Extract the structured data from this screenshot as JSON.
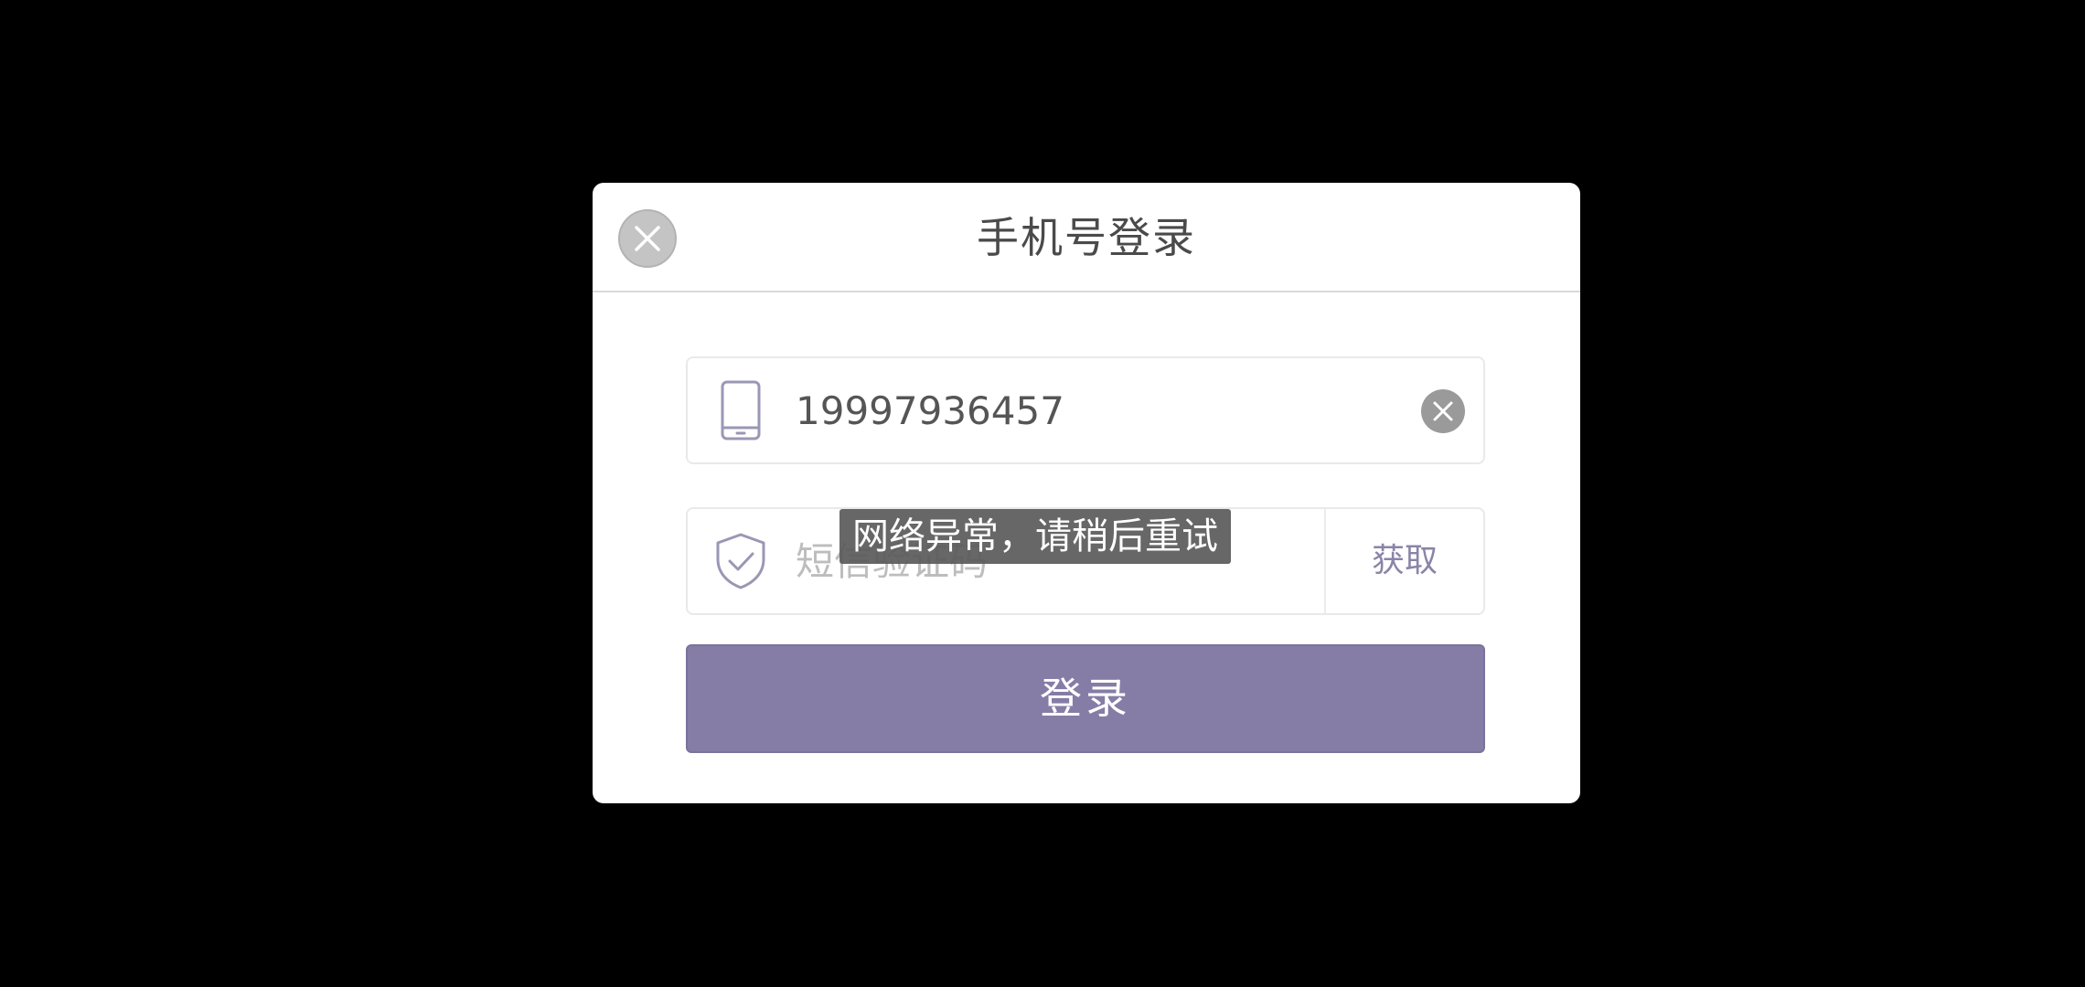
{
  "dialog": {
    "title": "手机号登录",
    "close_icon": "close-icon"
  },
  "phone_field": {
    "icon": "phone-icon",
    "value": "19997936457",
    "clear_icon": "clear-icon"
  },
  "code_field": {
    "icon": "shield-check-icon",
    "placeholder": "短信验证码",
    "get_code_label": "获取"
  },
  "login_button": {
    "label": "登录"
  },
  "toast": {
    "message": "网络异常，请稍后重试"
  },
  "colors": {
    "accent": "#857da6",
    "get_code_text": "#8a84a8",
    "background": "#000000"
  }
}
